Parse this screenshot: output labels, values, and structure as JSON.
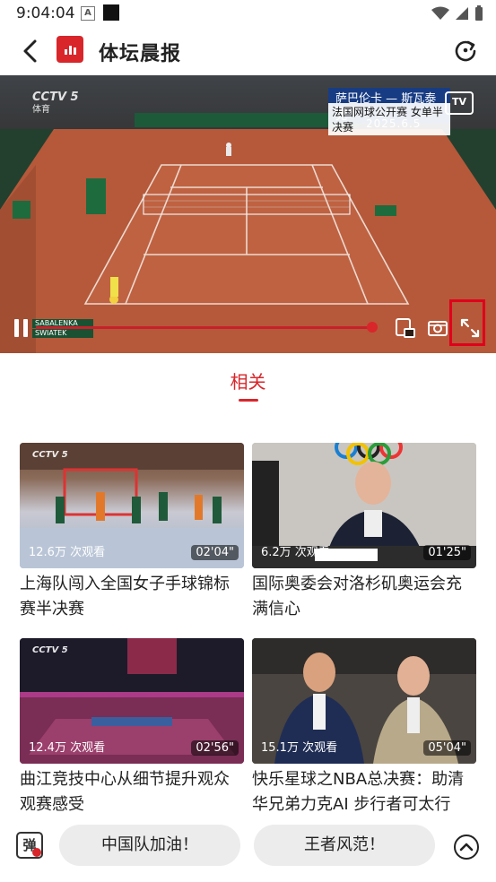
{
  "status": {
    "time": "9:04:04",
    "icon_a": "A"
  },
  "header": {
    "title": "体坛晨报"
  },
  "player": {
    "watermark_main": "CCTV 5",
    "watermark_sub": "体育",
    "banner_line1": "萨巴伦卡 — 斯瓦泰克",
    "banner_line2": "法国网球公开赛 女单半决赛",
    "banner_date": "2025.6.5",
    "tv_label": "TV",
    "score_line1": "SABALENKA",
    "score_line2": "SWIATEK",
    "progress": 0.75
  },
  "related": {
    "label": "相关"
  },
  "videos": [
    {
      "title": "上海队闯入全国女子手球锦标赛半决赛",
      "views": "12.6万 次观看",
      "duration": "02'04\""
    },
    {
      "title": "国际奥委会对洛杉矶奥运会充满信心",
      "views": "6.2万 次观看",
      "duration": "01'25\""
    },
    {
      "title": "曲江竞技中心从细节提升观众观赛感受",
      "views": "12.4万 次观看",
      "duration": "02'56\""
    },
    {
      "title": "快乐星球之NBA总决赛：助清华兄弟力克AI 步行者可太行",
      "views": "15.1万 次观看",
      "duration": "05'04\""
    }
  ],
  "bottom": {
    "danmu_icon": "弹",
    "chips": [
      "中国队加油！",
      "王者风范！"
    ]
  },
  "colors": {
    "accent": "#d8262b",
    "highlight_box": "#e0001b"
  }
}
